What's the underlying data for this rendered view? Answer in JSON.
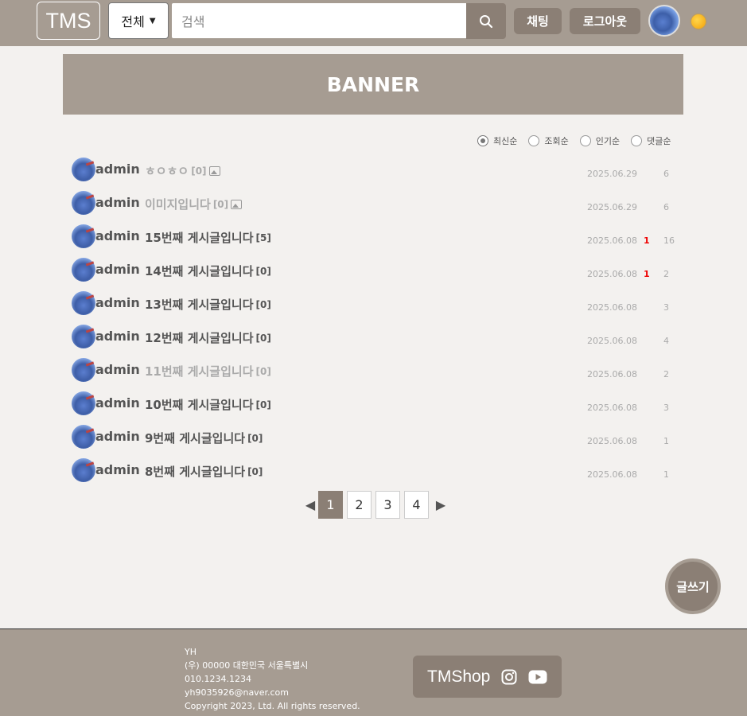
{
  "header": {
    "logo": "TMS",
    "category": "전체",
    "search_placeholder": "검색",
    "chat": "채팅",
    "logout": "로그아웃"
  },
  "banner": {
    "text": "BANNER"
  },
  "sort": [
    {
      "label": "최신순",
      "checked": true
    },
    {
      "label": "조회순",
      "checked": false
    },
    {
      "label": "인기순",
      "checked": false
    },
    {
      "label": "댓글순",
      "checked": false
    }
  ],
  "posts": [
    {
      "author": "admin",
      "title": "ㅎㅇㅎㅇ",
      "comments": "[0]",
      "has_image": true,
      "date": "2025.06.29",
      "likes": "",
      "views": "6",
      "muted": true
    },
    {
      "author": "admin",
      "title": "이미지입니다",
      "comments": "[0]",
      "has_image": true,
      "date": "2025.06.29",
      "likes": "",
      "views": "6",
      "muted": true
    },
    {
      "author": "admin",
      "title": "15번째 게시글입니다",
      "comments": "[5]",
      "has_image": false,
      "date": "2025.06.08",
      "likes": "1",
      "views": "16",
      "muted": false
    },
    {
      "author": "admin",
      "title": "14번째 게시글입니다",
      "comments": "[0]",
      "has_image": false,
      "date": "2025.06.08",
      "likes": "1",
      "views": "2",
      "muted": false
    },
    {
      "author": "admin",
      "title": "13번째 게시글입니다",
      "comments": "[0]",
      "has_image": false,
      "date": "2025.06.08",
      "likes": "",
      "views": "3",
      "muted": false
    },
    {
      "author": "admin",
      "title": "12번째 게시글입니다",
      "comments": "[0]",
      "has_image": false,
      "date": "2025.06.08",
      "likes": "",
      "views": "4",
      "muted": false
    },
    {
      "author": "admin",
      "title": "11번째 게시글입니다",
      "comments": "[0]",
      "has_image": false,
      "date": "2025.06.08",
      "likes": "",
      "views": "2",
      "muted": true
    },
    {
      "author": "admin",
      "title": "10번째 게시글입니다",
      "comments": "[0]",
      "has_image": false,
      "date": "2025.06.08",
      "likes": "",
      "views": "3",
      "muted": false
    },
    {
      "author": "admin",
      "title": "9번째 게시글입니다",
      "comments": "[0]",
      "has_image": false,
      "date": "2025.06.08",
      "likes": "",
      "views": "1",
      "muted": false
    },
    {
      "author": "admin",
      "title": "8번째 게시글입니다",
      "comments": "[0]",
      "has_image": false,
      "date": "2025.06.08",
      "likes": "",
      "views": "1",
      "muted": false
    }
  ],
  "pagination": {
    "pages": [
      "1",
      "2",
      "3",
      "4"
    ],
    "active": "1"
  },
  "write_button": "글쓰기",
  "footer": {
    "lines": [
      "YH",
      "(우) 00000 대한민국 서울특별시",
      "010.1234.1234",
      "yh9035926@naver.com",
      "Copyright 2023, Ltd. All rights reserved."
    ],
    "brand": "TMShop"
  },
  "colors": {
    "header_bg": "#a69c92",
    "accent": "#8b7f75",
    "page_bg": "#f3f1ef",
    "like_red": "#e00000"
  }
}
